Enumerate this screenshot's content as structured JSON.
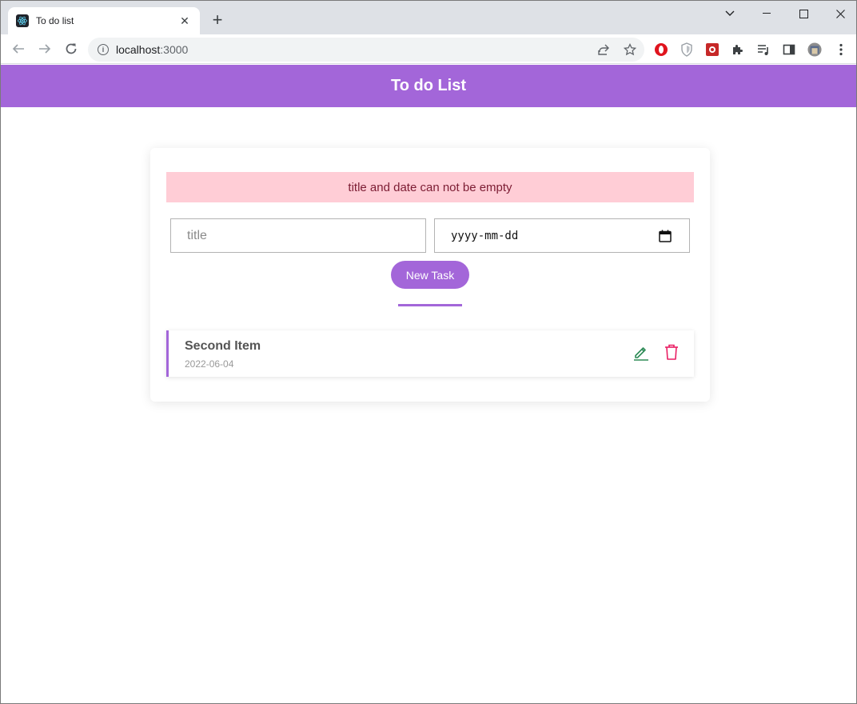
{
  "browser": {
    "tab": {
      "title": "To do list",
      "favicon": "react-icon",
      "close": "✕"
    },
    "new_tab": "+",
    "address": {
      "host": "localhost",
      "port": ":3000"
    }
  },
  "app": {
    "header_title": "To do List",
    "alert": "title and date can not be empty",
    "title_placeholder": "title",
    "date_placeholder": "yyyy-mm-dd",
    "new_task_label": "New Task",
    "tasks": [
      {
        "title": "Second Item",
        "date": "2022-06-04"
      }
    ],
    "colors": {
      "accent": "#a366d9",
      "alert_bg": "#ffcdd6",
      "edit": "#2e8b57",
      "delete": "#e91e63"
    }
  }
}
